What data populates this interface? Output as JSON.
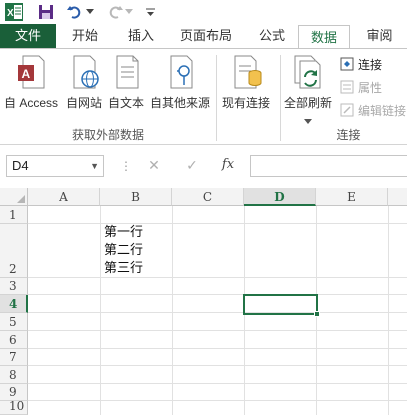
{
  "qat": {
    "app_icon": "excel-icon",
    "save_icon": "save-icon",
    "undo_icon": "undo-icon",
    "redo_icon": "redo-icon",
    "customize_icon": "customize-qat-icon"
  },
  "tabs": {
    "file": "文件",
    "home": "开始",
    "insert": "插入",
    "page_layout": "页面布局",
    "formulas": "公式",
    "data": "数据",
    "review": "审阅"
  },
  "ribbon": {
    "get_external": {
      "label": "获取外部数据",
      "access": "自 Access",
      "web": "自网站",
      "text": "自文本",
      "other": "自其他来源"
    },
    "existing": "现有连接",
    "refresh_all": "全部刷新",
    "connections": {
      "label": "连接",
      "connections_btn": "连接",
      "properties_btn": "属性",
      "edit_links_btn": "编辑链接"
    }
  },
  "formula_bar": {
    "name_box": "D4",
    "fx_label": "fx",
    "formula": ""
  },
  "sheet": {
    "columns": [
      "A",
      "B",
      "C",
      "D",
      "E"
    ],
    "rows": [
      "1",
      "2",
      "3",
      "4",
      "5",
      "6",
      "7",
      "8",
      "9",
      "10"
    ],
    "active_column": "D",
    "active_row": "4",
    "cell_b2_lines": [
      "第一行",
      "第二行",
      "第三行"
    ]
  },
  "colors": {
    "accent": "#217346",
    "header_bg": "#f3f3f3",
    "grid_line": "#e1e1e1"
  }
}
